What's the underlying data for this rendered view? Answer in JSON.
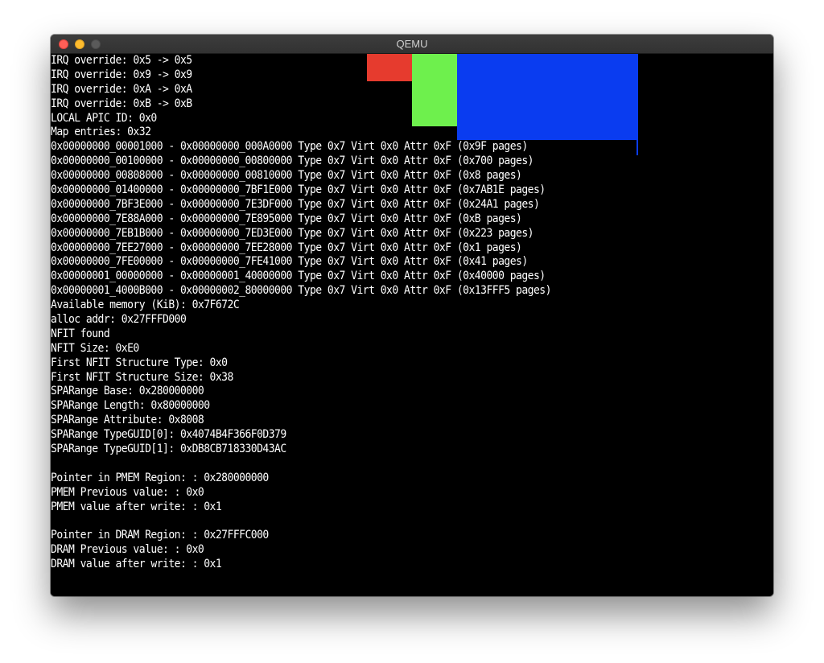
{
  "window": {
    "title": "QEMU"
  },
  "colors": {
    "red_block": "#e63b2e",
    "green_block": "#6ef04d",
    "blue_block": "#0a3cf0",
    "console_bg": "#000000",
    "console_text": "#ffffff"
  },
  "console_lines": [
    "IRQ override: 0x5 -> 0x5",
    "IRQ override: 0x9 -> 0x9",
    "IRQ override: 0xA -> 0xA",
    "IRQ override: 0xB -> 0xB",
    "LOCAL APIC ID: 0x0",
    "Map entries: 0x32",
    "0x00000000_00001000 - 0x00000000_000A0000 Type 0x7 Virt 0x0 Attr 0xF (0x9F pages)",
    "0x00000000_00100000 - 0x00000000_00800000 Type 0x7 Virt 0x0 Attr 0xF (0x700 pages)",
    "0x00000000_00808000 - 0x00000000_00810000 Type 0x7 Virt 0x0 Attr 0xF (0x8 pages)",
    "0x00000000_01400000 - 0x00000000_7BF1E000 Type 0x7 Virt 0x0 Attr 0xF (0x7AB1E pages)",
    "0x00000000_7BF3E000 - 0x00000000_7E3DF000 Type 0x7 Virt 0x0 Attr 0xF (0x24A1 pages)",
    "0x00000000_7E88A000 - 0x00000000_7E895000 Type 0x7 Virt 0x0 Attr 0xF (0xB pages)",
    "0x00000000_7EB1B000 - 0x00000000_7ED3E000 Type 0x7 Virt 0x0 Attr 0xF (0x223 pages)",
    "0x00000000_7EE27000 - 0x00000000_7EE28000 Type 0x7 Virt 0x0 Attr 0xF (0x1 pages)",
    "0x00000000_7FE00000 - 0x00000000_7FE41000 Type 0x7 Virt 0x0 Attr 0xF (0x41 pages)",
    "0x00000001_00000000 - 0x00000001_40000000 Type 0x7 Virt 0x0 Attr 0xF (0x40000 pages)",
    "0x00000001_4000B000 - 0x00000002_80000000 Type 0x7 Virt 0x0 Attr 0xF (0x13FFF5 pages)",
    "Available memory (KiB): 0x7F672C",
    "alloc addr: 0x27FFFD000",
    "NFIT found",
    "NFIT Size: 0xE0",
    "First NFIT Structure Type: 0x0",
    "First NFIT Structure Size: 0x38",
    "SPARange Base: 0x280000000",
    "SPARange Length: 0x80000000",
    "SPARange Attribute: 0x8008",
    "SPARange TypeGUID[0]: 0x4074B4F366F0D379",
    "SPARange TypeGUID[1]: 0xDB8CB718330D43AC",
    "",
    "Pointer in PMEM Region: : 0x280000000",
    "PMEM Previous value: : 0x0",
    "PMEM value after write: : 0x1",
    "",
    "Pointer in DRAM Region: : 0x27FFFC000",
    "DRAM Previous value: : 0x0",
    "DRAM value after write: : 0x1"
  ]
}
